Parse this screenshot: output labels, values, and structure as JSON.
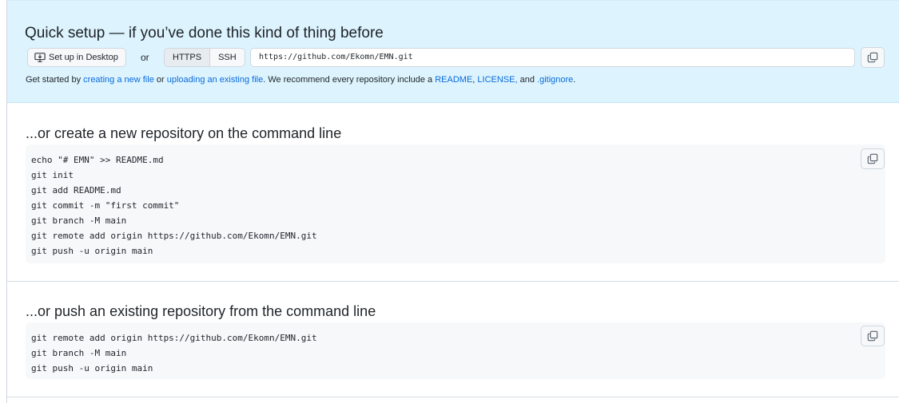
{
  "quick_setup": {
    "title": "Quick setup — if you’ve done this kind of thing before",
    "desktop_button": "Set up in Desktop",
    "or": "or",
    "protocols": [
      "HTTPS",
      "SSH"
    ],
    "url": "https://github.com/Ekomn/EMN.git",
    "get_started_prefix": "Get started by ",
    "link_new_file": "creating a new file",
    "or_text": " or ",
    "link_upload": "uploading an existing file",
    "recommend_text": ". We recommend every repository include a ",
    "link_readme": "README",
    "comma": ", ",
    "link_license": "LICENSE,",
    "and_text": " and ",
    "link_gitignore": ".gitignore",
    "period": "."
  },
  "new_repo": {
    "title": "...or create a new repository on the command line",
    "code": "echo \"# EMN\" >> README.md\ngit init\ngit add README.md\ngit commit -m \"first commit\"\ngit branch -M main\ngit remote add origin https://github.com/Ekomn/EMN.git\ngit push -u origin main"
  },
  "push_existing": {
    "title": "...or push an existing repository from the command line",
    "code": "git remote add origin https://github.com/Ekomn/EMN.git\ngit branch -M main\ngit push -u origin main"
  },
  "icons": {
    "desktop": "desktop-download-icon",
    "copy": "copy-icon"
  },
  "colors": {
    "quick_bg": "#ddf4ff",
    "link": "#0969da",
    "code_bg": "#f6f8fa"
  }
}
